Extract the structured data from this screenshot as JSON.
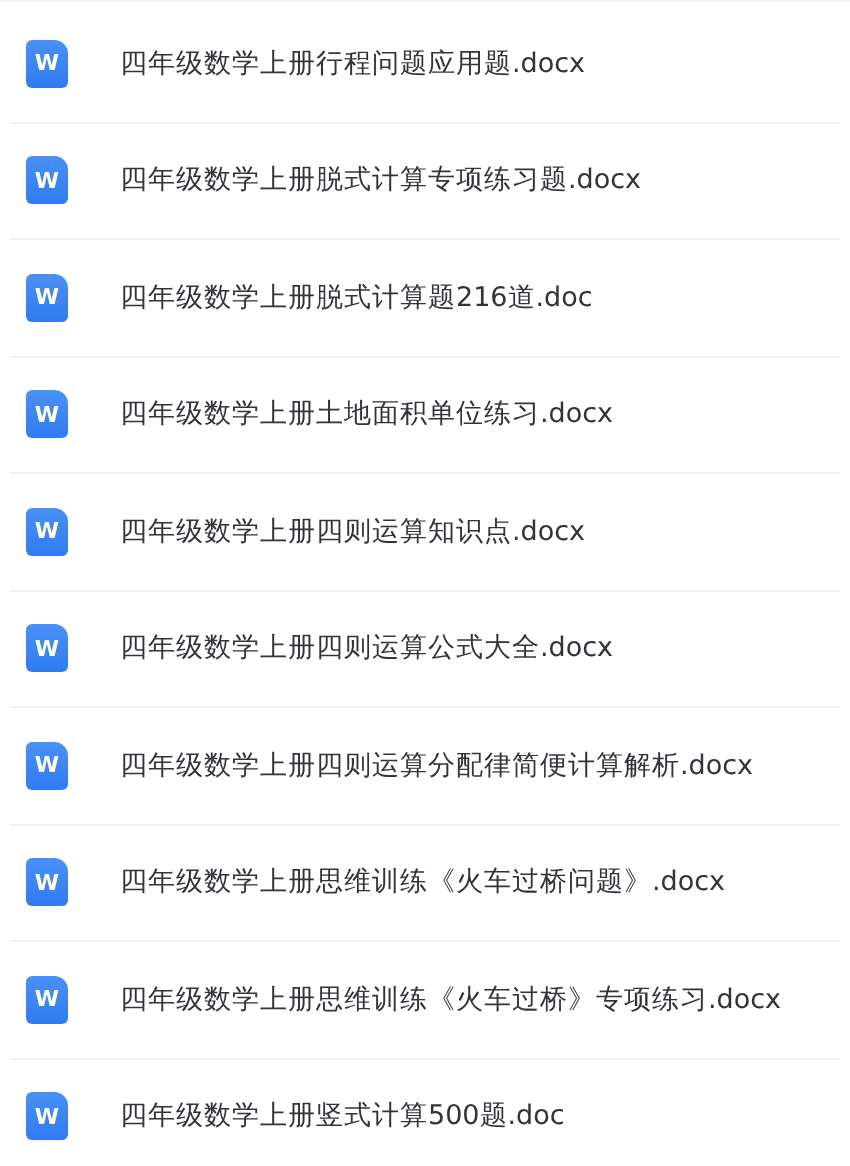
{
  "files": [
    {
      "icon_letter": "W",
      "name": "四年级数学上册行程问题应用题.docx"
    },
    {
      "icon_letter": "W",
      "name": "四年级数学上册脱式计算专项练习题.docx"
    },
    {
      "icon_letter": "W",
      "name": "四年级数学上册脱式计算题216道.doc"
    },
    {
      "icon_letter": "W",
      "name": "四年级数学上册土地面积单位练习.docx"
    },
    {
      "icon_letter": "W",
      "name": "四年级数学上册四则运算知识点.docx"
    },
    {
      "icon_letter": "W",
      "name": "四年级数学上册四则运算公式大全.docx"
    },
    {
      "icon_letter": "W",
      "name": "四年级数学上册四则运算分配律简便计算解析.docx"
    },
    {
      "icon_letter": "W",
      "name": "四年级数学上册思维训练《火车过桥问题》.docx"
    },
    {
      "icon_letter": "W",
      "name": "四年级数学上册思维训练《火车过桥》专项练习.docx"
    },
    {
      "icon_letter": "W",
      "name": "四年级数学上册竖式计算500题.doc"
    }
  ]
}
